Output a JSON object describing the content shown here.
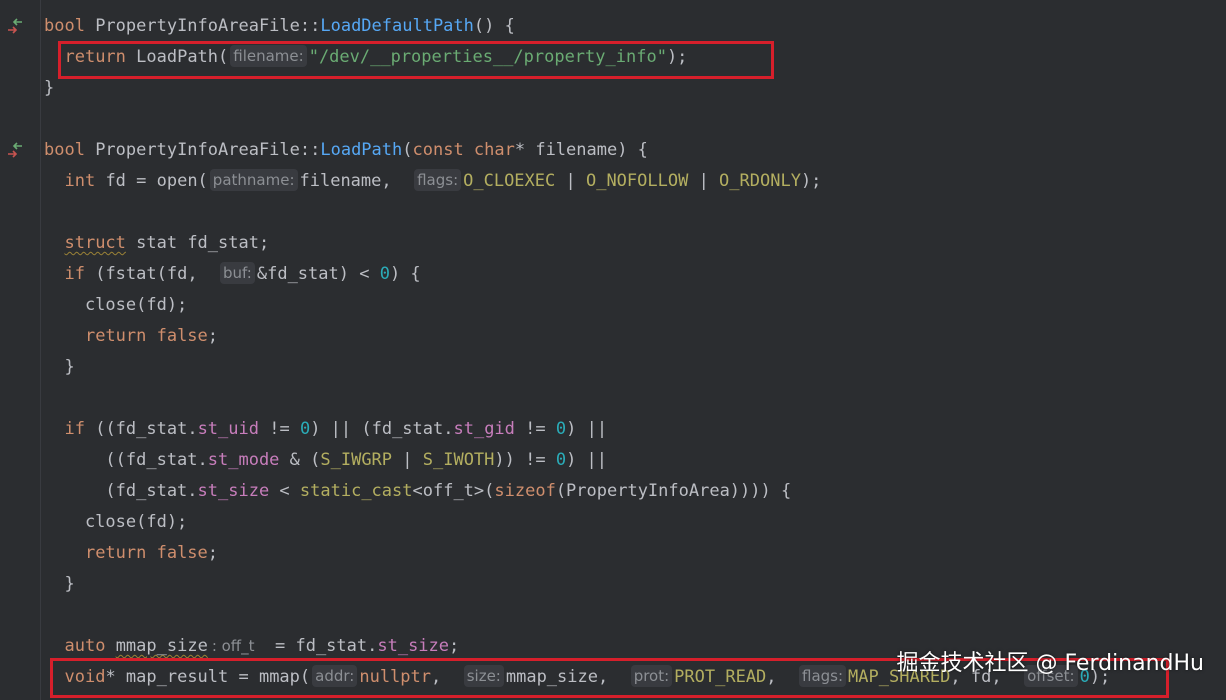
{
  "editor": {
    "language": "cpp",
    "lines": [
      {
        "segments": [
          [
            "kw",
            "bool"
          ],
          [
            "t",
            " PropertyInfoAreaFile::"
          ],
          [
            "fnc",
            "LoadDefaultPath"
          ],
          [
            "t",
            "() {"
          ]
        ]
      },
      {
        "segments": [
          [
            "t",
            "  "
          ],
          [
            "kw",
            "return"
          ],
          [
            "t",
            " LoadPath("
          ],
          [
            "hint",
            "filename:"
          ],
          [
            "str",
            "\"/dev/__properties__/property_info\""
          ],
          [
            "t",
            ");"
          ]
        ]
      },
      {
        "segments": [
          [
            "t",
            "}"
          ]
        ]
      },
      {
        "segments": []
      },
      {
        "segments": [
          [
            "kw",
            "bool"
          ],
          [
            "t",
            " PropertyInfoAreaFile::"
          ],
          [
            "fnc",
            "LoadPath"
          ],
          [
            "t",
            "("
          ],
          [
            "kw",
            "const char"
          ],
          [
            "t",
            "* filename) {"
          ]
        ]
      },
      {
        "segments": [
          [
            "t",
            "  "
          ],
          [
            "kw",
            "int"
          ],
          [
            "t",
            " fd = open("
          ],
          [
            "hint",
            "pathname:"
          ],
          [
            "t",
            "filename,  "
          ],
          [
            "hint",
            "flags:"
          ],
          [
            "mac",
            "O_CLOEXEC"
          ],
          [
            "t",
            " | "
          ],
          [
            "mac",
            "O_NOFOLLOW"
          ],
          [
            "t",
            " | "
          ],
          [
            "mac",
            "O_RDONLY"
          ],
          [
            "t",
            ");"
          ]
        ]
      },
      {
        "segments": []
      },
      {
        "segments": [
          [
            "t",
            "  "
          ],
          [
            "kwwavy",
            "struct"
          ],
          [
            "t",
            " stat fd_stat;"
          ]
        ]
      },
      {
        "segments": [
          [
            "t",
            "  "
          ],
          [
            "kw",
            "if"
          ],
          [
            "t",
            " (fstat(fd,  "
          ],
          [
            "hint",
            "buf:"
          ],
          [
            "t",
            "&fd_stat) < "
          ],
          [
            "num",
            "0"
          ],
          [
            "t",
            ") {"
          ]
        ]
      },
      {
        "segments": [
          [
            "t",
            "    close(fd);"
          ]
        ]
      },
      {
        "segments": [
          [
            "t",
            "    "
          ],
          [
            "kw",
            "return false"
          ],
          [
            "t",
            ";"
          ]
        ]
      },
      {
        "segments": [
          [
            "t",
            "  }"
          ]
        ]
      },
      {
        "segments": []
      },
      {
        "segments": [
          [
            "t",
            "  "
          ],
          [
            "kw",
            "if"
          ],
          [
            "t",
            " ((fd_stat."
          ],
          [
            "fld",
            "st_uid"
          ],
          [
            "t",
            " != "
          ],
          [
            "num",
            "0"
          ],
          [
            "t",
            ") || (fd_stat."
          ],
          [
            "fld",
            "st_gid"
          ],
          [
            "t",
            " != "
          ],
          [
            "num",
            "0"
          ],
          [
            "t",
            ") ||"
          ]
        ]
      },
      {
        "segments": [
          [
            "t",
            "      ((fd_stat."
          ],
          [
            "fld",
            "st_mode"
          ],
          [
            "t",
            " & ("
          ],
          [
            "mac",
            "S_IWGRP"
          ],
          [
            "t",
            " | "
          ],
          [
            "mac",
            "S_IWOTH"
          ],
          [
            "t",
            ")) != "
          ],
          [
            "num",
            "0"
          ],
          [
            "t",
            ") ||"
          ]
        ]
      },
      {
        "segments": [
          [
            "t",
            "      (fd_stat."
          ],
          [
            "fld",
            "st_size"
          ],
          [
            "t",
            " < "
          ],
          [
            "mac",
            "static_cast"
          ],
          [
            "t",
            "<off_t>("
          ],
          [
            "kw",
            "sizeof"
          ],
          [
            "t",
            "(PropertyInfoArea)))) {"
          ]
        ]
      },
      {
        "segments": [
          [
            "t",
            "    close(fd);"
          ]
        ]
      },
      {
        "segments": [
          [
            "t",
            "    "
          ],
          [
            "kw",
            "return false"
          ],
          [
            "t",
            ";"
          ]
        ]
      },
      {
        "segments": [
          [
            "t",
            "  }"
          ]
        ]
      },
      {
        "segments": []
      },
      {
        "segments": [
          [
            "t",
            "  "
          ],
          [
            "kw",
            "auto"
          ],
          [
            "t",
            " "
          ],
          [
            "wavy",
            "mmap_size"
          ],
          [
            "thint",
            ": off_t"
          ],
          [
            "t",
            "  = fd_stat."
          ],
          [
            "fld",
            "st_size"
          ],
          [
            "t",
            ";"
          ]
        ]
      },
      {
        "segments": [
          [
            "t",
            "  "
          ],
          [
            "kw",
            "void"
          ],
          [
            "t",
            "* map_result = mmap("
          ],
          [
            "hint",
            "addr:"
          ],
          [
            "kw",
            "nullptr"
          ],
          [
            "t",
            ",  "
          ],
          [
            "hint",
            "size:"
          ],
          [
            "t",
            "mmap_size,  "
          ],
          [
            "hint",
            "prot:"
          ],
          [
            "mac",
            "PROT_READ"
          ],
          [
            "t",
            ",  "
          ],
          [
            "hint",
            "flags:"
          ],
          [
            "mac",
            "MAP_SHARED"
          ],
          [
            "t",
            ", fd,  "
          ],
          [
            "hint",
            "offset:"
          ],
          [
            "num",
            "0"
          ],
          [
            "t",
            ");"
          ]
        ]
      }
    ]
  },
  "watermark": "掘金技术社区 @ FerdinandHu",
  "colors": {
    "background": "#2b2d30",
    "keyword": "#cf8e6d",
    "function": "#56a8f5",
    "field": "#c77dbb",
    "number": "#2aacb8",
    "string": "#6aab73",
    "macro": "#b3ae60",
    "highlight_box": "#d61f2b"
  },
  "icons": [
    "override-implementation-icon",
    "override-implementation-icon"
  ]
}
